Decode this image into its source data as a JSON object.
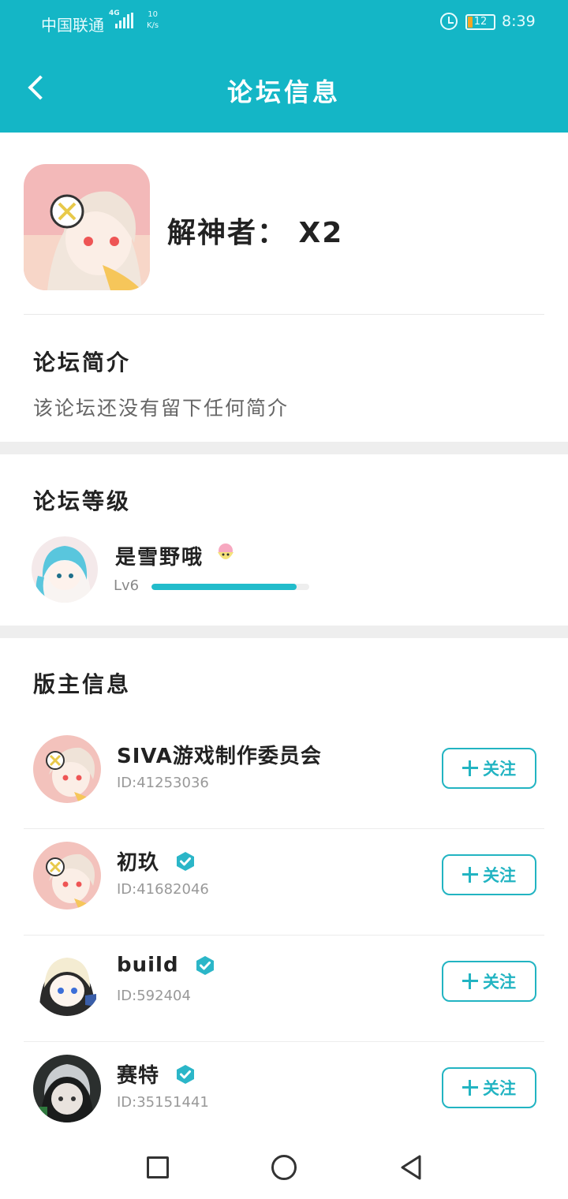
{
  "status_bar": {
    "carrier": "中国联通",
    "network": "4G",
    "speed_value": "10",
    "speed_unit": "K/s",
    "battery": "12",
    "time": "8:39"
  },
  "header": {
    "title": "论坛信息"
  },
  "forum": {
    "name": "解神者： X2",
    "intro_title": "论坛简介",
    "intro_text": "该论坛还没有留下任何简介"
  },
  "forum_level": {
    "title": "论坛等级",
    "user": "是雪野哦",
    "level": "Lv6",
    "progress": 0.92
  },
  "moderators": {
    "title": "版主信息",
    "follow_label": "关注",
    "items": [
      {
        "name": "SIVA游戏制作委员会",
        "id": "ID:41253036",
        "verified": false
      },
      {
        "name": "初玖",
        "id": "ID:41682046",
        "verified": true
      },
      {
        "name": "build",
        "id": "ID:592404",
        "verified": true
      },
      {
        "name": "赛特",
        "id": "ID:35151441",
        "verified": true
      }
    ]
  },
  "colors": {
    "header": "#14b6c6",
    "accent": "#22b4c2",
    "progress": "#22bccb"
  }
}
